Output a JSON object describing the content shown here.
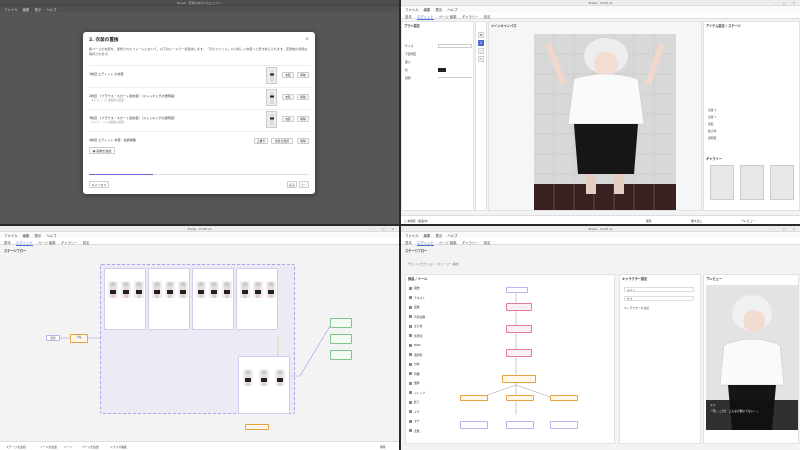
{
  "menu": [
    "ファイル",
    "編集",
    "表示",
    "ヘルプ"
  ],
  "tabs": [
    "基本",
    "エディット",
    "ページ 編集",
    "ギャラリー",
    "設定"
  ],
  "q1": {
    "title": "Break - 形態の中のプロジェクト",
    "modal": {
      "title": "2. 衣装の置換",
      "close": "×",
      "desc": "各ページの衣装を、選択されたフレームにおいて、以下のルールで一括置換します。「元のファイル」から新しい衣装へと置き換えられます。変更前の状態は保存されます。",
      "rows": [
        {
          "label": "1枚目 エディット の衣装",
          "sub": "",
          "btns": [
            "衣装",
            "削除"
          ]
        },
        {
          "label": "2枚目 （ブラウス・スカート風衣装）（ストッキングの透明度）",
          "sub": "キャラ — ○○ 衣装名の変更",
          "btns": [
            "衣装",
            "削除"
          ]
        },
        {
          "label": "3枚目 （ブラウス・スカート風衣装）（ストッキングの透明度）",
          "sub": "キャラ — ○○ 衣装名の変更",
          "btns": [
            "衣装",
            "削除"
          ]
        },
        {
          "label": "4枚目 エディット 衣装・最終調整",
          "sub": "",
          "btns": [
            "上書き",
            "衣装を選択",
            "削除"
          ]
        }
      ],
      "add": "画像を追加",
      "progress": 0.29,
      "cancel": "キャンセル",
      "back": "戻る",
      "next": "次へ"
    }
  },
  "q2": {
    "title": "Break - Draft v2",
    "left_title": "ブラシ設定",
    "left_fields": [
      "サイズ",
      "不透明度",
      "硬さ",
      "色",
      "間隔"
    ],
    "center_title": "メインキャンバス",
    "right_title": "アイテム設定 / ステージ",
    "right_fields": [
      "位置 X",
      "位置 Y",
      "回転",
      "拡大率",
      "透明度"
    ],
    "gallery_title": "ギャラリー",
    "status": [
      "○ 未保存（編集中）",
      "保存",
      "書き出し",
      "プレビュー"
    ]
  },
  "q3": {
    "title": "Break - Draft v2",
    "section": "ステージフロー",
    "start": "開始",
    "branch": "分岐",
    "bottom": [
      "ステージを追加",
      "ノードを追加",
      "シーン",
      "ページを追加",
      "シナリオ編集"
    ],
    "save": "保存"
  },
  "q4": {
    "title": "Break - Draft v2",
    "section": "ステージフロー",
    "subsection": "アセットとセクション（ストーリー 構成）",
    "palette_title": "部品 / ツール",
    "palette_items": [
      "開始",
      "テキスト",
      "画像",
      "背景画像",
      "立ち絵",
      "効果音",
      "BGM",
      "選択肢",
      "分岐",
      "待機",
      "遷移",
      "ジャンプ",
      "終了",
      "メモ",
      "タグ",
      "変数"
    ],
    "char_title": "キャラクター設定",
    "chars": [
      "メイン",
      "サブ"
    ],
    "add_char": "キャラクターを追加",
    "preview_title": "プレビュー",
    "dialog": "「何… これ？ こんなの聞いてない…」",
    "speaker": "メイ"
  }
}
